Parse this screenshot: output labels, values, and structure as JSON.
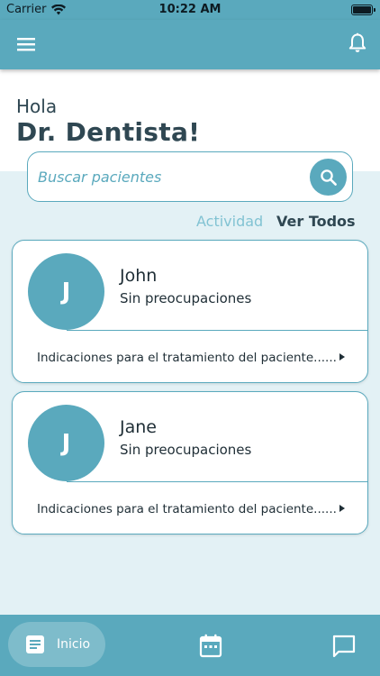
{
  "status_bar": {
    "carrier": "Carrier",
    "time": "10:22 AM"
  },
  "app_bar": {
    "menu_icon": "menu-icon",
    "notification_icon": "bell-icon"
  },
  "greeting": {
    "hola": "Hola",
    "name": "Dr. Dentista!"
  },
  "search": {
    "placeholder": "Buscar pacientes",
    "value": "",
    "icon": "search-icon"
  },
  "filters": {
    "actividad": "Actividad",
    "ver_todos": "Ver Todos",
    "active": "ver_todos"
  },
  "patients": [
    {
      "initial": "J",
      "name": "John",
      "status": "Sin preocupaciones",
      "indications": "Indicaciones para el tratamiento del paciente......"
    },
    {
      "initial": "J",
      "name": "Jane",
      "status": "Sin preocupaciones",
      "indications": "Indicaciones para el tratamiento del paciente......"
    }
  ],
  "bottom_nav": {
    "inicio": "Inicio",
    "items": [
      "document-icon",
      "calendar-icon",
      "chat-icon"
    ]
  },
  "colors": {
    "primary": "#5aa9bd",
    "content_background": "#e3f1f5",
    "text_dark": "#2f4752",
    "tab_inactive": "#82c3d3"
  }
}
